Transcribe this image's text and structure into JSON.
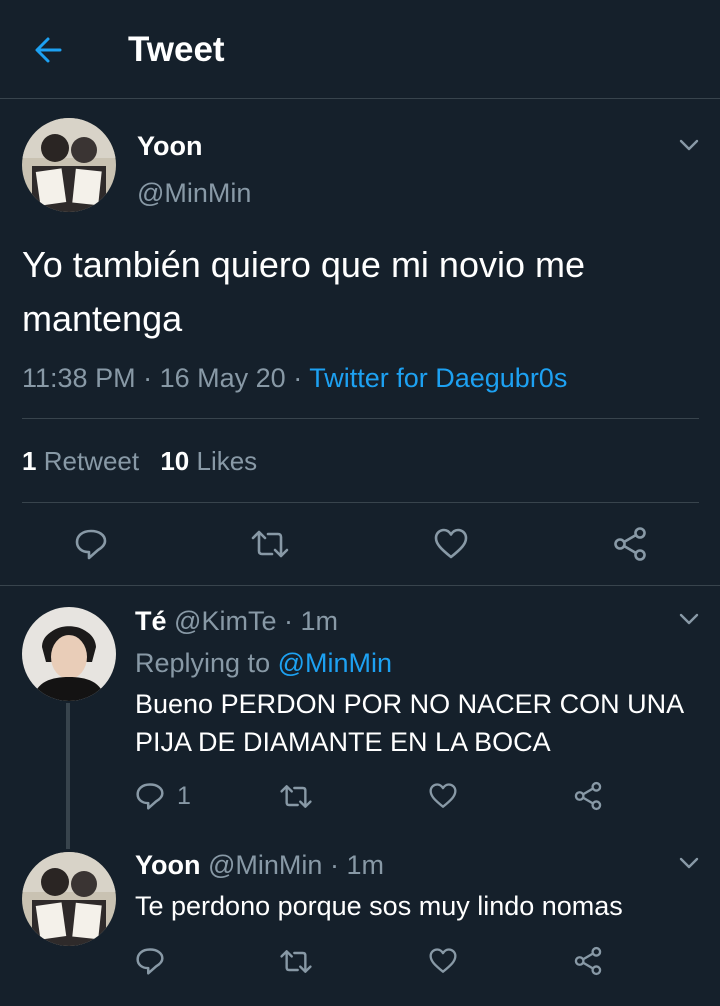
{
  "header": {
    "title": "Tweet"
  },
  "main_tweet": {
    "display_name": "Yoon",
    "handle": "@MinMin",
    "text_line1": "Yo también quiero que mi novio me",
    "text_line2": "mantenga",
    "time": "11:38 PM",
    "dot1": "·",
    "date": "16 May 20",
    "dot2": "·",
    "source": "Twitter for Daegubr0s",
    "retweet_count": "1",
    "retweet_label": "Retweet",
    "like_count": "10",
    "like_label": "Likes"
  },
  "replies": [
    {
      "display_name": "Té",
      "handle": "@KimTe",
      "dot": "·",
      "time": "1m",
      "replying_prefix": "Replying to",
      "replying_to": "@MinMin",
      "text_line1": "Bueno PERDON POR NO NACER CON UNA",
      "text_line2": "PIJA DE DIAMANTE EN LA BOCA",
      "reply_count": "1"
    },
    {
      "display_name": "Yoon",
      "handle": "@MinMin",
      "dot": "·",
      "time": "1m",
      "text_line1": "Te perdono porque sos muy lindo nomas"
    }
  ],
  "colors": {
    "background": "#15202b",
    "divider": "#38444d",
    "muted": "#8899a6",
    "accent": "#1da1f2"
  },
  "icons": [
    "back-arrow-icon",
    "chevron-down-icon",
    "reply-icon",
    "retweet-icon",
    "like-icon",
    "share-icon"
  ]
}
